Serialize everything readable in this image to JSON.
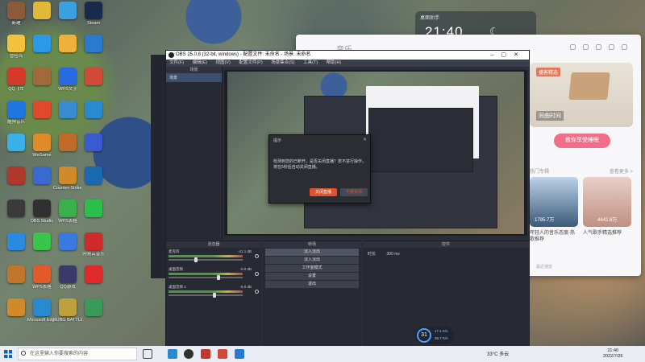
{
  "desktop_icons": [
    {
      "label": "新建",
      "color": "#8a5a3a"
    },
    {
      "label": "冒险岛",
      "color": "#f2c33a"
    },
    {
      "label": "QQ飞车",
      "color": "#d43a2a"
    },
    {
      "label": "酷狗音乐",
      "color": "#1f76e0"
    },
    {
      "label": "",
      "color": "#3ab0e8"
    },
    {
      "label": "",
      "color": "#b0382a"
    },
    {
      "label": "",
      "color": "#3a3a3a"
    },
    {
      "label": "",
      "color": "#2a8ae0"
    },
    {
      "label": "",
      "color": "#c0762a"
    },
    {
      "label": "",
      "color": "#d08a2a"
    },
    {
      "label": "",
      "color": "#e0b83a"
    },
    {
      "label": "",
      "color": "#2a9ae8"
    },
    {
      "label": "",
      "color": "#a06a3a"
    },
    {
      "label": "",
      "color": "#e04a2a"
    },
    {
      "label": "WeGame",
      "color": "#e08a2a"
    },
    {
      "label": "",
      "color": "#3a6ad0"
    },
    {
      "label": "OBS Studio",
      "color": "#303030"
    },
    {
      "label": "",
      "color": "#3ac44a"
    },
    {
      "label": "WPS表格",
      "color": "#e05a2a"
    },
    {
      "label": "Microsoft Edge",
      "color": "#2a8ad0"
    },
    {
      "label": "",
      "color": "#3aa0e0"
    },
    {
      "label": "",
      "color": "#f0b03a"
    },
    {
      "label": "WPS文字",
      "color": "#2a6ae0"
    },
    {
      "label": "",
      "color": "#3a8ad0"
    },
    {
      "label": "",
      "color": "#c06a2a"
    },
    {
      "label": "Counter-Strike Global...",
      "color": "#d08a2a"
    },
    {
      "label": "WPS表格",
      "color": "#3ab04a"
    },
    {
      "label": "",
      "color": "#3a7ae0"
    },
    {
      "label": "QQ游戏",
      "color": "#3a3a6a"
    },
    {
      "label": "PUBG BATTLEGR...",
      "color": "#c0a03a"
    },
    {
      "label": "Steam",
      "color": "#1a2a4a"
    },
    {
      "label": "",
      "color": "#2a7ad0"
    },
    {
      "label": "",
      "color": "#d04a3a"
    },
    {
      "label": "",
      "color": "#2a8ad0"
    },
    {
      "label": "",
      "color": "#3a5ad0"
    },
    {
      "label": "",
      "color": "#1a6ab0"
    },
    {
      "label": "",
      "color": "#2ac04a"
    },
    {
      "label": "网易云音乐",
      "color": "#d02a2a"
    },
    {
      "label": "",
      "color": "#e02a2a"
    },
    {
      "label": "",
      "color": "#3a9a5a"
    }
  ],
  "clock_widget": {
    "label": "桌面助手",
    "time": "21:40"
  },
  "music_app": {
    "tabs": [
      "音乐",
      "",
      "",
      ""
    ],
    "tag": "播客精选",
    "card_title": "同曲时间",
    "button": "教你享受睡眠",
    "subtitle": "热门专辑",
    "more": "查看更多 >",
    "captions": [
      "年轻人的音乐态度-热歌推荐",
      "人气歌手精选推荐"
    ],
    "plays": [
      "1795.7万",
      "4442.6万"
    ],
    "footer": "最近播放"
  },
  "obs": {
    "title": "OBS 25.0.8 (32-bit, windows) - 配置文件: 未命名 - 场景: 未命名",
    "menu": [
      "文件(F)",
      "编辑(E)",
      "视图(V)",
      "配置文件(P)",
      "场景集合(S)",
      "工具(T)",
      "帮助(H)"
    ],
    "scenes_header": "场景",
    "scene_item": "场景",
    "dialog": {
      "title": "提示",
      "message": "检测到您的已断开，是否关闭直播？若不进行操作，将在5秒后自动关闭直播。",
      "confirm": "关闭直播",
      "cancel": "不要关闭"
    },
    "mixer_header": "混音器",
    "mixer": [
      {
        "name": "麦克风",
        "db": "-41.1 dB",
        "level": 0.35
      },
      {
        "name": "桌面音频",
        "db": "-0.0 dB",
        "level": 0.65
      },
      {
        "name": "桌面音频 2",
        "db": "-5.0 dB",
        "level": 0.6
      }
    ],
    "transitions_header": "转场",
    "transitions": [
      "淡入淡出",
      "淡入淡出",
      "工作室模式",
      "设置",
      "退出"
    ],
    "controls_header": "控件",
    "duration_label": "时长",
    "duration_value": "300 ms"
  },
  "network": {
    "value": "31",
    "up": "17.1 K/s",
    "down": "36.7 K/s"
  },
  "taskbar": {
    "search_placeholder": "在这里输入你要搜索的内容",
    "weather": "33°C 多云",
    "time": "21:40",
    "date": "2022/7/26"
  }
}
